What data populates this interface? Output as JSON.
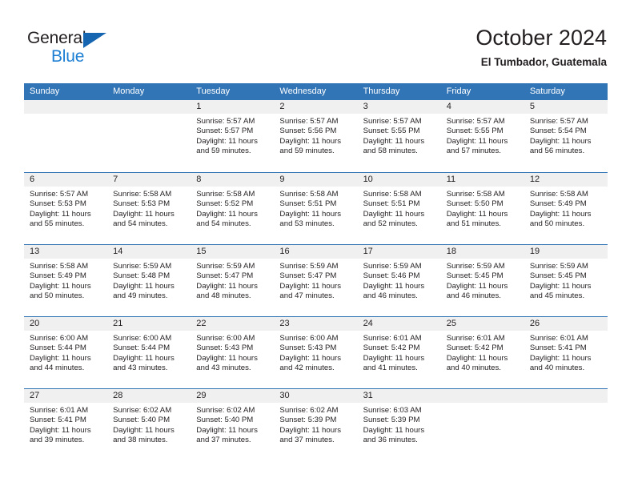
{
  "brand": {
    "name_part1": "General",
    "name_part2": "Blue",
    "triangle_color": "#1565b0",
    "blue_text_color": "#1c7fd4"
  },
  "header": {
    "month_title": "October 2024",
    "location": "El Tumbador, Guatemala"
  },
  "theme": {
    "header_blue": "#3275b6",
    "day_band_gray": "#f0f0f0",
    "text_color": "#231f20"
  },
  "weekdays": [
    "Sunday",
    "Monday",
    "Tuesday",
    "Wednesday",
    "Thursday",
    "Friday",
    "Saturday"
  ],
  "weeks": [
    [
      {
        "day": "",
        "lines": []
      },
      {
        "day": "",
        "lines": []
      },
      {
        "day": "1",
        "lines": [
          "Sunrise: 5:57 AM",
          "Sunset: 5:57 PM",
          "Daylight: 11 hours",
          "and 59 minutes."
        ]
      },
      {
        "day": "2",
        "lines": [
          "Sunrise: 5:57 AM",
          "Sunset: 5:56 PM",
          "Daylight: 11 hours",
          "and 59 minutes."
        ]
      },
      {
        "day": "3",
        "lines": [
          "Sunrise: 5:57 AM",
          "Sunset: 5:55 PM",
          "Daylight: 11 hours",
          "and 58 minutes."
        ]
      },
      {
        "day": "4",
        "lines": [
          "Sunrise: 5:57 AM",
          "Sunset: 5:55 PM",
          "Daylight: 11 hours",
          "and 57 minutes."
        ]
      },
      {
        "day": "5",
        "lines": [
          "Sunrise: 5:57 AM",
          "Sunset: 5:54 PM",
          "Daylight: 11 hours",
          "and 56 minutes."
        ]
      }
    ],
    [
      {
        "day": "6",
        "lines": [
          "Sunrise: 5:57 AM",
          "Sunset: 5:53 PM",
          "Daylight: 11 hours",
          "and 55 minutes."
        ]
      },
      {
        "day": "7",
        "lines": [
          "Sunrise: 5:58 AM",
          "Sunset: 5:53 PM",
          "Daylight: 11 hours",
          "and 54 minutes."
        ]
      },
      {
        "day": "8",
        "lines": [
          "Sunrise: 5:58 AM",
          "Sunset: 5:52 PM",
          "Daylight: 11 hours",
          "and 54 minutes."
        ]
      },
      {
        "day": "9",
        "lines": [
          "Sunrise: 5:58 AM",
          "Sunset: 5:51 PM",
          "Daylight: 11 hours",
          "and 53 minutes."
        ]
      },
      {
        "day": "10",
        "lines": [
          "Sunrise: 5:58 AM",
          "Sunset: 5:51 PM",
          "Daylight: 11 hours",
          "and 52 minutes."
        ]
      },
      {
        "day": "11",
        "lines": [
          "Sunrise: 5:58 AM",
          "Sunset: 5:50 PM",
          "Daylight: 11 hours",
          "and 51 minutes."
        ]
      },
      {
        "day": "12",
        "lines": [
          "Sunrise: 5:58 AM",
          "Sunset: 5:49 PM",
          "Daylight: 11 hours",
          "and 50 minutes."
        ]
      }
    ],
    [
      {
        "day": "13",
        "lines": [
          "Sunrise: 5:58 AM",
          "Sunset: 5:49 PM",
          "Daylight: 11 hours",
          "and 50 minutes."
        ]
      },
      {
        "day": "14",
        "lines": [
          "Sunrise: 5:59 AM",
          "Sunset: 5:48 PM",
          "Daylight: 11 hours",
          "and 49 minutes."
        ]
      },
      {
        "day": "15",
        "lines": [
          "Sunrise: 5:59 AM",
          "Sunset: 5:47 PM",
          "Daylight: 11 hours",
          "and 48 minutes."
        ]
      },
      {
        "day": "16",
        "lines": [
          "Sunrise: 5:59 AM",
          "Sunset: 5:47 PM",
          "Daylight: 11 hours",
          "and 47 minutes."
        ]
      },
      {
        "day": "17",
        "lines": [
          "Sunrise: 5:59 AM",
          "Sunset: 5:46 PM",
          "Daylight: 11 hours",
          "and 46 minutes."
        ]
      },
      {
        "day": "18",
        "lines": [
          "Sunrise: 5:59 AM",
          "Sunset: 5:45 PM",
          "Daylight: 11 hours",
          "and 46 minutes."
        ]
      },
      {
        "day": "19",
        "lines": [
          "Sunrise: 5:59 AM",
          "Sunset: 5:45 PM",
          "Daylight: 11 hours",
          "and 45 minutes."
        ]
      }
    ],
    [
      {
        "day": "20",
        "lines": [
          "Sunrise: 6:00 AM",
          "Sunset: 5:44 PM",
          "Daylight: 11 hours",
          "and 44 minutes."
        ]
      },
      {
        "day": "21",
        "lines": [
          "Sunrise: 6:00 AM",
          "Sunset: 5:44 PM",
          "Daylight: 11 hours",
          "and 43 minutes."
        ]
      },
      {
        "day": "22",
        "lines": [
          "Sunrise: 6:00 AM",
          "Sunset: 5:43 PM",
          "Daylight: 11 hours",
          "and 43 minutes."
        ]
      },
      {
        "day": "23",
        "lines": [
          "Sunrise: 6:00 AM",
          "Sunset: 5:43 PM",
          "Daylight: 11 hours",
          "and 42 minutes."
        ]
      },
      {
        "day": "24",
        "lines": [
          "Sunrise: 6:01 AM",
          "Sunset: 5:42 PM",
          "Daylight: 11 hours",
          "and 41 minutes."
        ]
      },
      {
        "day": "25",
        "lines": [
          "Sunrise: 6:01 AM",
          "Sunset: 5:42 PM",
          "Daylight: 11 hours",
          "and 40 minutes."
        ]
      },
      {
        "day": "26",
        "lines": [
          "Sunrise: 6:01 AM",
          "Sunset: 5:41 PM",
          "Daylight: 11 hours",
          "and 40 minutes."
        ]
      }
    ],
    [
      {
        "day": "27",
        "lines": [
          "Sunrise: 6:01 AM",
          "Sunset: 5:41 PM",
          "Daylight: 11 hours",
          "and 39 minutes."
        ]
      },
      {
        "day": "28",
        "lines": [
          "Sunrise: 6:02 AM",
          "Sunset: 5:40 PM",
          "Daylight: 11 hours",
          "and 38 minutes."
        ]
      },
      {
        "day": "29",
        "lines": [
          "Sunrise: 6:02 AM",
          "Sunset: 5:40 PM",
          "Daylight: 11 hours",
          "and 37 minutes."
        ]
      },
      {
        "day": "30",
        "lines": [
          "Sunrise: 6:02 AM",
          "Sunset: 5:39 PM",
          "Daylight: 11 hours",
          "and 37 minutes."
        ]
      },
      {
        "day": "31",
        "lines": [
          "Sunrise: 6:03 AM",
          "Sunset: 5:39 PM",
          "Daylight: 11 hours",
          "and 36 minutes."
        ]
      },
      {
        "day": "",
        "lines": []
      },
      {
        "day": "",
        "lines": []
      }
    ]
  ]
}
